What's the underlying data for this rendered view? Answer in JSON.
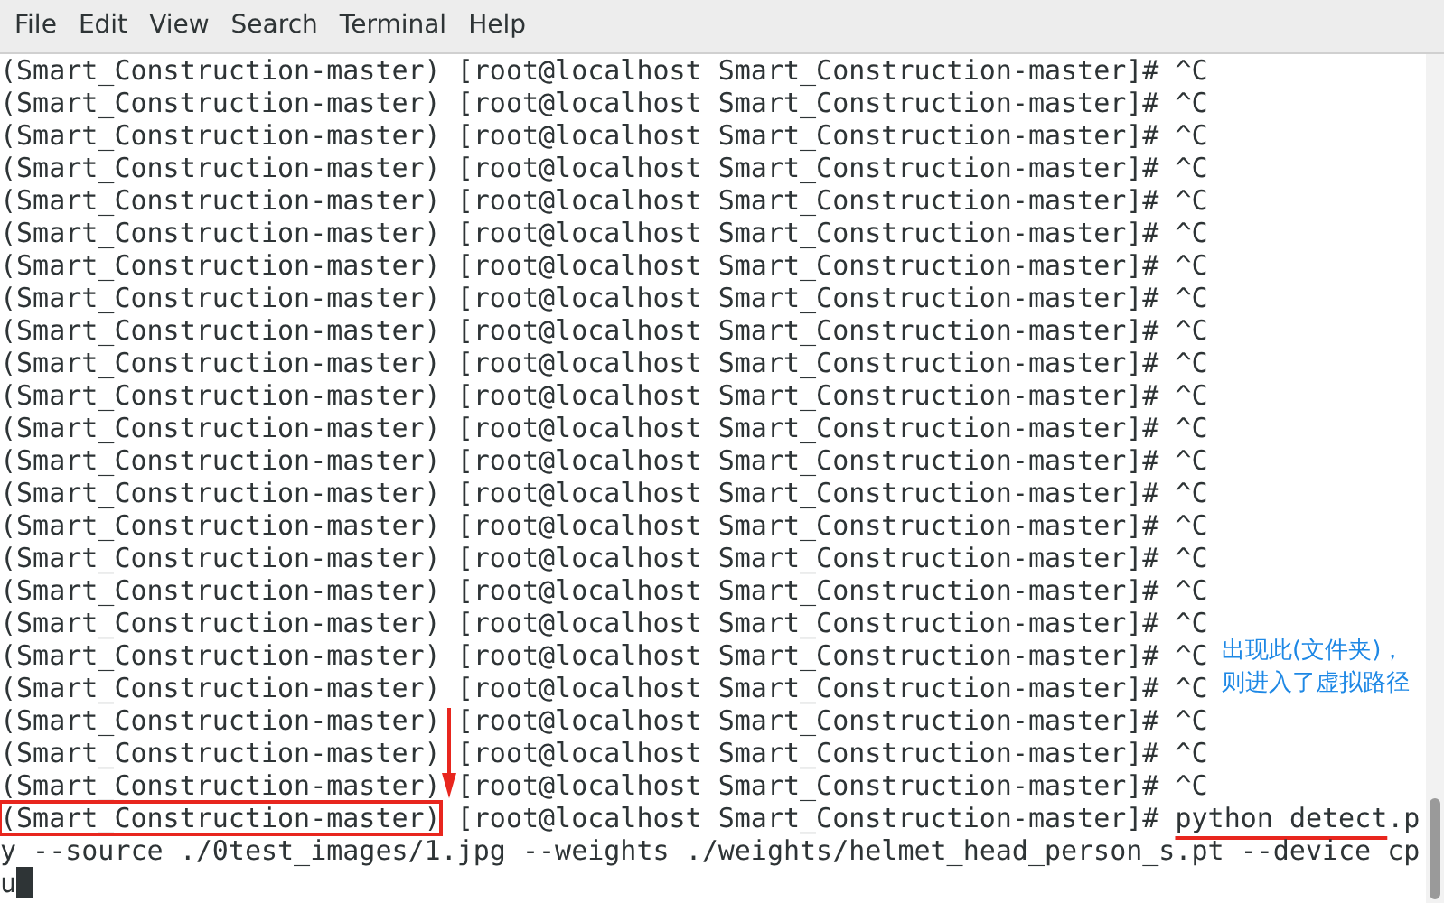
{
  "menu": [
    "File",
    "Edit",
    "View",
    "Search",
    "Terminal",
    "Help"
  ],
  "lines": [
    {
      "kind": "prompt",
      "env": "(Smart_Construction-master)",
      "prompt": " [root@localhost Smart_Construction-master]# ",
      "command": "^C",
      "env_boxed": false
    },
    {
      "kind": "prompt",
      "env": "(Smart_Construction-master)",
      "prompt": " [root@localhost Smart_Construction-master]# ",
      "command": "^C",
      "env_boxed": false
    },
    {
      "kind": "prompt",
      "env": "(Smart_Construction-master)",
      "prompt": " [root@localhost Smart_Construction-master]# ",
      "command": "^C",
      "env_boxed": false
    },
    {
      "kind": "prompt",
      "env": "(Smart_Construction-master)",
      "prompt": " [root@localhost Smart_Construction-master]# ",
      "command": "^C",
      "env_boxed": false
    },
    {
      "kind": "prompt",
      "env": "(Smart_Construction-master)",
      "prompt": " [root@localhost Smart_Construction-master]# ",
      "command": "^C",
      "env_boxed": false
    },
    {
      "kind": "prompt",
      "env": "(Smart_Construction-master)",
      "prompt": " [root@localhost Smart_Construction-master]# ",
      "command": "^C",
      "env_boxed": false
    },
    {
      "kind": "prompt",
      "env": "(Smart_Construction-master)",
      "prompt": " [root@localhost Smart_Construction-master]# ",
      "command": "^C",
      "env_boxed": false
    },
    {
      "kind": "prompt",
      "env": "(Smart_Construction-master)",
      "prompt": " [root@localhost Smart_Construction-master]# ",
      "command": "^C",
      "env_boxed": false
    },
    {
      "kind": "prompt",
      "env": "(Smart_Construction-master)",
      "prompt": " [root@localhost Smart_Construction-master]# ",
      "command": "^C",
      "env_boxed": false
    },
    {
      "kind": "prompt",
      "env": "(Smart_Construction-master)",
      "prompt": " [root@localhost Smart_Construction-master]# ",
      "command": "^C",
      "env_boxed": false
    },
    {
      "kind": "prompt",
      "env": "(Smart_Construction-master)",
      "prompt": " [root@localhost Smart_Construction-master]# ",
      "command": "^C",
      "env_boxed": false
    },
    {
      "kind": "prompt",
      "env": "(Smart_Construction-master)",
      "prompt": " [root@localhost Smart_Construction-master]# ",
      "command": "^C",
      "env_boxed": false
    },
    {
      "kind": "prompt",
      "env": "(Smart_Construction-master)",
      "prompt": " [root@localhost Smart_Construction-master]# ",
      "command": "^C",
      "env_boxed": false
    },
    {
      "kind": "prompt",
      "env": "(Smart_Construction-master)",
      "prompt": " [root@localhost Smart_Construction-master]# ",
      "command": "^C",
      "env_boxed": false
    },
    {
      "kind": "prompt",
      "env": "(Smart_Construction-master)",
      "prompt": " [root@localhost Smart_Construction-master]# ",
      "command": "^C",
      "env_boxed": false
    },
    {
      "kind": "prompt",
      "env": "(Smart_Construction-master)",
      "prompt": " [root@localhost Smart_Construction-master]# ",
      "command": "^C",
      "env_boxed": false
    },
    {
      "kind": "prompt",
      "env": "(Smart_Construction-master)",
      "prompt": " [root@localhost Smart_Construction-master]# ",
      "command": "^C",
      "env_boxed": false
    },
    {
      "kind": "prompt",
      "env": "(Smart_Construction-master)",
      "prompt": " [root@localhost Smart_Construction-master]# ",
      "command": "^C",
      "env_boxed": false
    },
    {
      "kind": "prompt",
      "env": "(Smart_Construction-master)",
      "prompt": " [root@localhost Smart_Construction-master]# ",
      "command": "^C",
      "env_boxed": false
    },
    {
      "kind": "prompt",
      "env": "(Smart_Construction-master)",
      "prompt": " [root@localhost Smart_Construction-master]# ",
      "command": "^C",
      "env_boxed": false
    },
    {
      "kind": "prompt",
      "env": "(Smart_Construction-master)",
      "prompt": " [root@localhost Smart_Construction-master]# ",
      "command": "^C",
      "env_boxed": false
    },
    {
      "kind": "prompt",
      "env": "(Smart_Construction-master)",
      "prompt": " [root@localhost Smart_Construction-master]# ",
      "command": "^C",
      "env_boxed": false
    },
    {
      "kind": "prompt",
      "env": "(Smart_Construction-master)",
      "prompt": " [root@localhost Smart_Construction-master]# ",
      "command": "^C",
      "env_boxed": false
    },
    {
      "kind": "prompt",
      "env": "(Smart_Construction-master)",
      "prompt": " [root@localhost Smart_Construction-master]# ",
      "command_underlined": "python detect",
      "command": ".p",
      "env_boxed": true
    },
    {
      "kind": "wrap",
      "text": "y --source ./0test_images/1.jpg --weights ./weights/helmet_head_person_s.pt --device cp",
      "cursor": false
    },
    {
      "kind": "wrap",
      "text": "u",
      "cursor": true
    }
  ],
  "annotation": {
    "text": "出现此(文件夹)，则进入了虚拟路径"
  }
}
